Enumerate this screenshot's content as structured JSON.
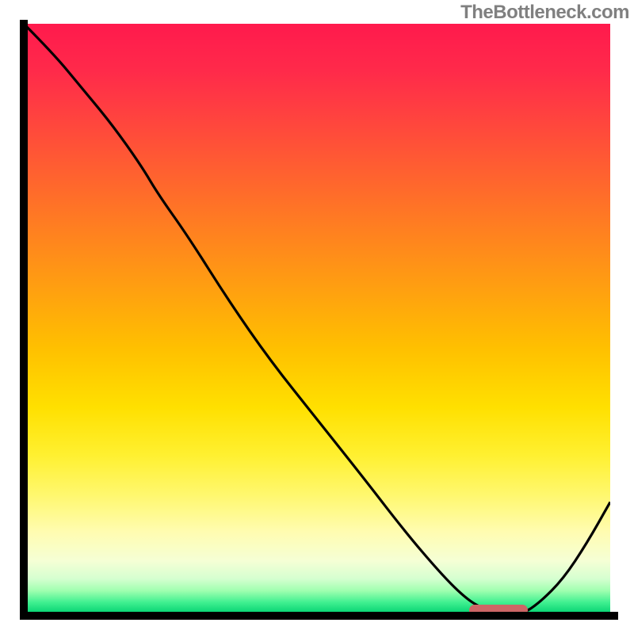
{
  "watermark": "TheBottleneck.com",
  "colors": {
    "curve": "#000000",
    "marker": "#cc6666",
    "axis": "#000000"
  },
  "chart_data": {
    "type": "line",
    "title": "",
    "xlabel": "",
    "ylabel": "",
    "xlim": [
      0,
      100
    ],
    "ylim": [
      0,
      100
    ],
    "x": [
      0,
      5,
      10,
      15,
      20,
      23,
      28,
      35,
      42,
      50,
      58,
      65,
      71,
      75,
      78,
      82,
      85,
      88,
      92,
      96,
      100
    ],
    "values": [
      100,
      95,
      89,
      83,
      76,
      71,
      64,
      53,
      43,
      33,
      23,
      14,
      7,
      3,
      1,
      0,
      0,
      2,
      6,
      12,
      19
    ],
    "marker": {
      "x_start": 76,
      "x_end": 86,
      "y": 0
    },
    "gradient_note": "background is a red-to-green vertical heatmap"
  }
}
